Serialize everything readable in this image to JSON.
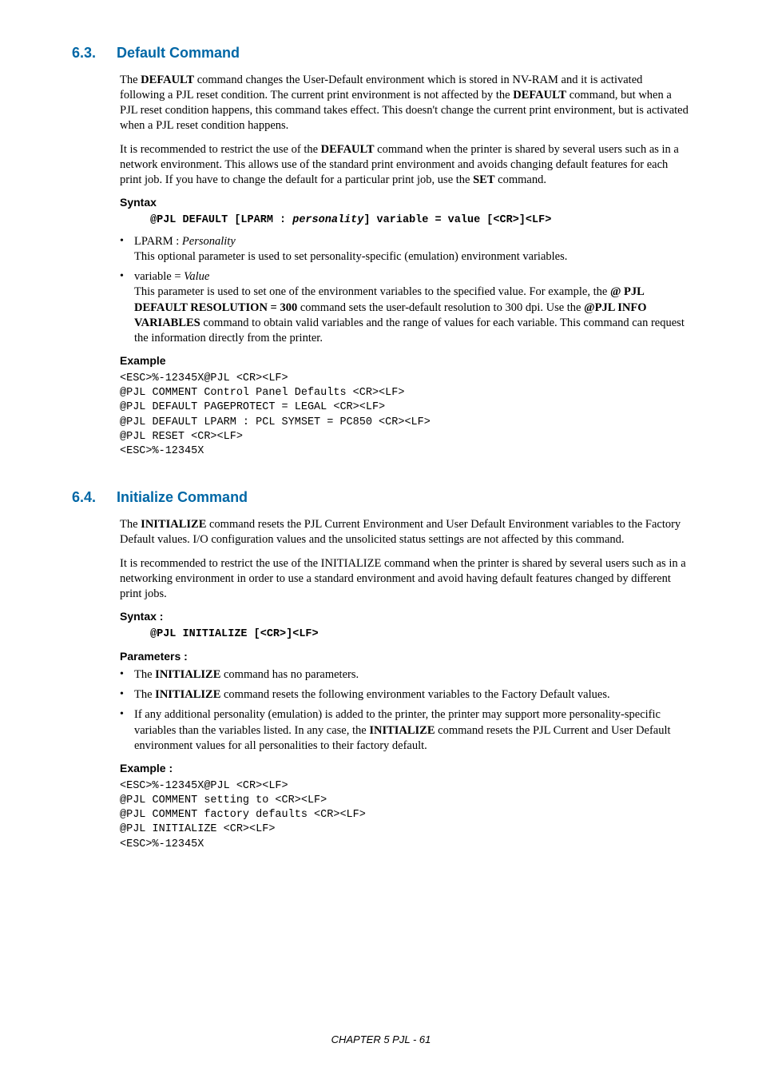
{
  "section63": {
    "number": "6.3.",
    "title": "Default Command",
    "para1_parts": [
      "The ",
      "DEFAULT",
      " command changes the User-Default environment which is stored in NV-RAM and it is activated following a PJL reset condition.  The current print environment is not affected by the ",
      "DEFAULT",
      " command, but  when a PJL reset condition happens, this command takes effect. This doesn't change the current print environment, but is activated when a PJL reset condition happens."
    ],
    "para2_parts": [
      "It is recommended to restrict the use of the ",
      "DEFAULT",
      " command when the printer is shared by several users such as in a network environment. This allows use of the standard print environment and avoids changing default features for each print job.   If you have to change the default for a particular print job, use the ",
      "SET",
      " command."
    ],
    "syntax_label": "Syntax",
    "syntax_prefix": "@PJL DEFAULT [LPARM : ",
    "syntax_mid": "personality",
    "syntax_suffix": "] variable = value [<CR>]<LF>",
    "bullet1_head_a": "LPARM : ",
    "bullet1_head_b": "Personality",
    "bullet1_body": "This optional parameter is used to set personality-specific (emulation) environment variables.",
    "bullet2_head_a": "variable = ",
    "bullet2_head_b": "Value",
    "bullet2_body_parts": [
      "This parameter is used to set one of the environment variables to the specified value.   For example, the ",
      "@ PJL DEFAULT RESOLUTION = 300",
      " command sets the user-default resolution to 300 dpi. Use the ",
      "@PJL INFO VARIABLES",
      " command to obtain valid variables and the range of values for each variable. This command can request the information directly from the printer."
    ],
    "example_label": "Example",
    "example_code": "<ESC>%-12345X@PJL <CR><LF>\n@PJL COMMENT Control Panel Defaults <CR><LF>\n@PJL DEFAULT PAGEPROTECT = LEGAL <CR><LF>\n@PJL DEFAULT LPARM : PCL SYMSET = PC850 <CR><LF>\n@PJL RESET <CR><LF>\n<ESC>%-12345X"
  },
  "section64": {
    "number": "6.4.",
    "title": "Initialize Command",
    "para1_parts": [
      "The ",
      "INITIALIZE",
      " command resets the PJL Current Environment and User Default Environment variables to the Factory Default values. I/O configuration values and the unsolicited status settings are not affected by this command."
    ],
    "para2": "It is recommended to restrict the use of the INITIALIZE command when the printer is shared by several users such as in a networking environment in order to use a standard environment and avoid having default features changed by different print jobs.",
    "syntax_label": "Syntax :",
    "syntax_line": "@PJL INITIALIZE [<CR>]<LF>",
    "params_label": "Parameters :",
    "b1_parts": [
      "The ",
      "INITIALIZE",
      " command has no parameters."
    ],
    "b2_parts": [
      "The ",
      "INITIALIZE",
      " command resets the following environment variables to the Factory Default values."
    ],
    "b3_parts": [
      "If any additional personality (emulation) is added to the printer, the printer may support more personality-specific variables than the variables listed.  In any case, the ",
      "INITIALIZE",
      " command resets the PJL Current and User Default environment values for all personalities to their factory default."
    ],
    "example_label": "Example :",
    "example_code": "<ESC>%-12345X@PJL <CR><LF>\n@PJL COMMENT setting to <CR><LF>\n@PJL COMMENT factory defaults <CR><LF>\n@PJL INITIALIZE <CR><LF>\n<ESC>%-12345X"
  },
  "footer": "CHAPTER 5 PJL - 61"
}
